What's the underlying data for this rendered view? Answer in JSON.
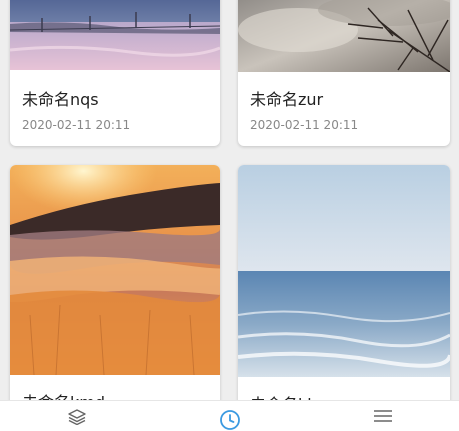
{
  "cards": [
    {
      "title": "未命名nqs",
      "date": "2020-02-11 20:11",
      "image": "snowy-field-fence-at-dusk"
    },
    {
      "title": "未命名zur",
      "date": "2020-02-11 20:11",
      "image": "bare-tree-branches-cloudy-sky"
    },
    {
      "title": "未命名kmd",
      "date": "",
      "image": "sunset-over-sea-of-clouds"
    },
    {
      "title": "未命名khm",
      "date": "",
      "image": "calm-sea-pale-sky"
    }
  ],
  "tabbar": {
    "items": [
      {
        "icon": "layers-icon",
        "active": false
      },
      {
        "icon": "clock-icon",
        "active": true
      },
      {
        "icon": "list-icon",
        "active": false
      }
    ],
    "active_color": "#3b9ae1",
    "inactive_color": "#666666"
  }
}
